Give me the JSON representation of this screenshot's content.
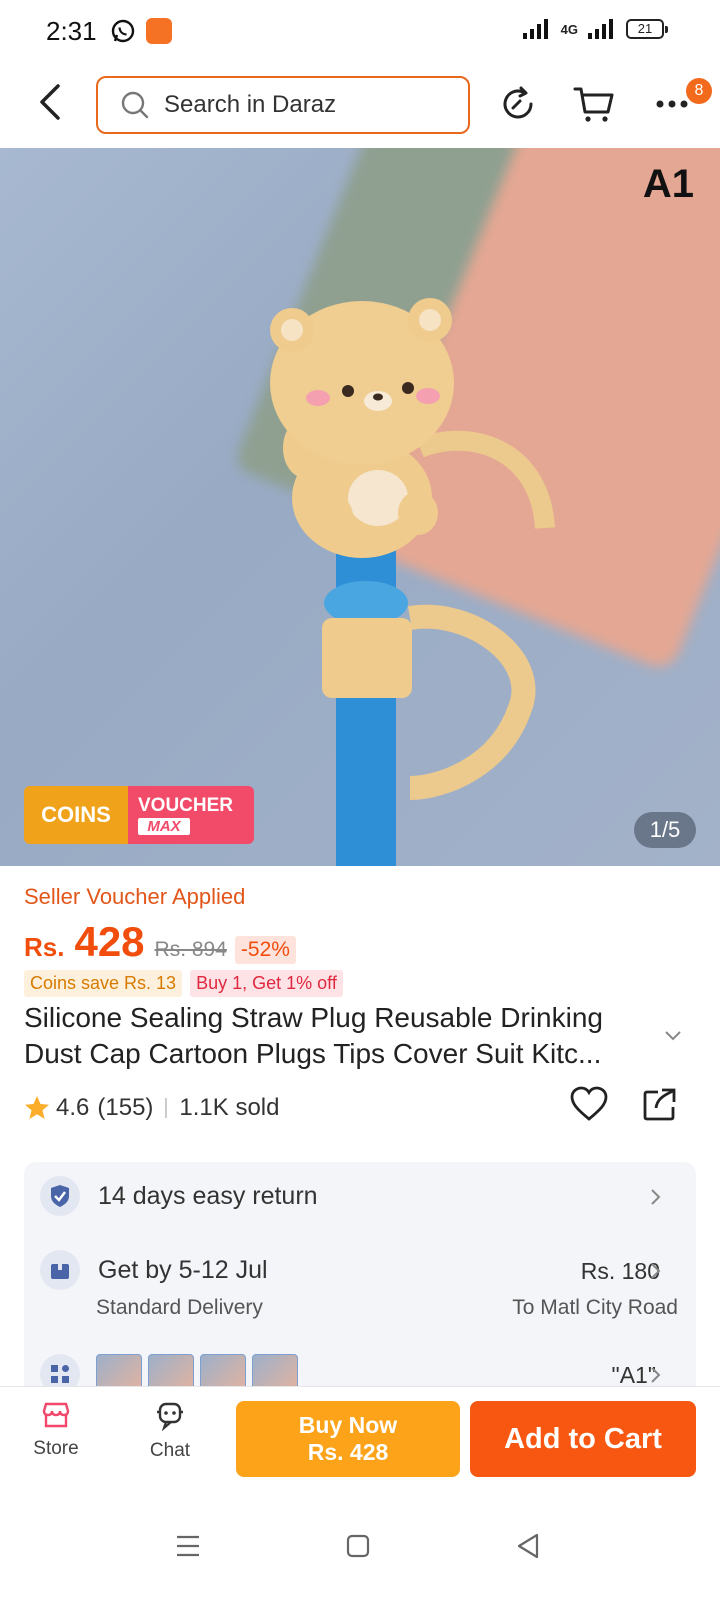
{
  "status_bar": {
    "time": "2:31",
    "network": "4G",
    "battery": "21"
  },
  "header": {
    "search_placeholder": "Search in Daraz",
    "more_badge": "8"
  },
  "hero": {
    "variant_label": "A1",
    "pager": "1/5",
    "coins_label": "COINS",
    "voucher_label": "VOUCHER",
    "voucher_sub": "MAX"
  },
  "price": {
    "seller_voucher": "Seller Voucher Applied",
    "currency": "Rs.",
    "current": "428",
    "original": "Rs. 894",
    "discount": "-52%",
    "coins_save": "Coins save Rs. 13",
    "buy_offer": "Buy 1, Get 1% off"
  },
  "product": {
    "title": "Silicone Sealing Straw Plug Reusable Drinking Dust Cap Cartoon Plugs Tips Cover Suit Kitc...",
    "rating": "4.6",
    "reviews": "(155)",
    "sold": "1.1K sold"
  },
  "service": {
    "return_text": "14 days easy return",
    "delivery_text": "Get by 5-12 Jul",
    "delivery_type": "Standard Delivery",
    "delivery_price": "Rs. 180",
    "delivery_to": "To Matl City Road",
    "variant_selected": "\"A1\""
  },
  "bottom_bar": {
    "store_label": "Store",
    "chat_label": "Chat",
    "buy_now_label": "Buy Now",
    "buy_now_price": "Rs. 428",
    "add_to_cart_label": "Add to Cart"
  },
  "colors": {
    "accent": "#f85712",
    "buy_now": "#fda319",
    "coins": "#f0a21a",
    "voucher": "#f24b69"
  }
}
